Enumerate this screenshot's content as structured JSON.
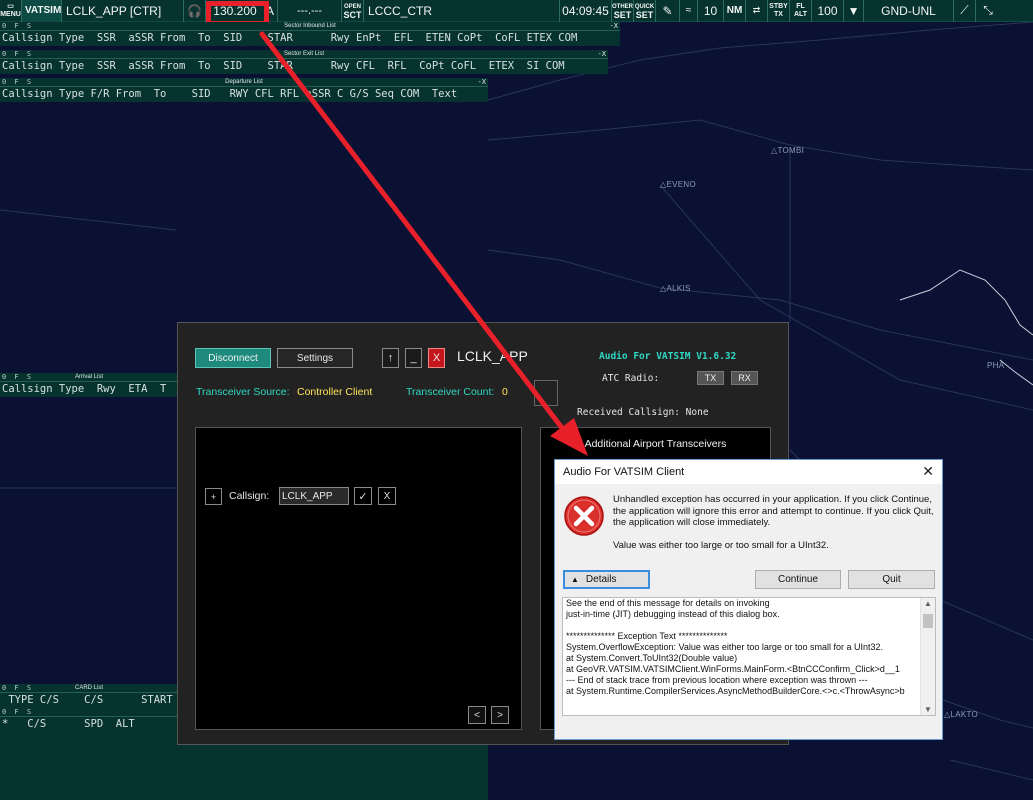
{
  "toolbar": {
    "menu": "MENU",
    "logo": "VATSIM",
    "position": "LCLK_APP [CTR]",
    "frequency": "130.200",
    "freq_suffix": "A",
    "secondary_freq": "---.---",
    "open_sct": [
      "OPEN",
      "SCT"
    ],
    "sector": "LCCC_CTR",
    "time": "04:09:45",
    "other_set": [
      "OTHER",
      "SET"
    ],
    "quick_set": [
      "QUICK",
      "SET"
    ],
    "range": "10",
    "unit": "NM",
    "stby": [
      "STBY",
      "TX"
    ],
    "fl_alt": [
      "FL",
      "ALT"
    ],
    "alt_value": "100",
    "filter": "GND-UNL"
  },
  "lists": {
    "inbound": {
      "title": "Sector Inbound List",
      "ofs": "0 F S",
      "ctl": "-X",
      "header": "Callsign Type  SSR  aSSR From  To  SID    STAR      Rwy EnPt  EFL  ETEN CoPt  CoFL ETEX COM"
    },
    "exit": {
      "title": "Sector Exit List",
      "ofs": "0 F S",
      "ctl": "-X",
      "header": "Callsign Type  SSR  aSSR From  To  SID    STAR      Rwy CFL  RFL  CoPt CoFL  ETEX  SI COM"
    },
    "departure": {
      "title": "Departure List",
      "ofs": "0 F S",
      "ctl": "-X",
      "header": "Callsign Type F/R From  To    SID   RWY CFL RFL aSSR C G/S Seq COM  Text"
    },
    "arrival": {
      "title": "Arrival List",
      "ofs": "0 F S",
      "header": "Callsign Type  Rwy  ETA  T"
    },
    "card": {
      "title": "CARD List",
      "ofs": "0 F S",
      "header": " TYPE C/S    C/S      START"
    },
    "bottom": {
      "ofs": "0 F S",
      "header": "*   C/S      SPD  ALT"
    }
  },
  "waypoints": [
    "TOMBI",
    "EVENO",
    "ALKIS",
    "PHA",
    "LAKTO"
  ],
  "afv": {
    "disconnect": "Disconnect",
    "settings": "Settings",
    "up": "↑",
    "minimize": "_",
    "close": "X",
    "title": "LCLK_APP",
    "version": "Audio For VATSIM V1.6.32",
    "atc_radio": "ATC Radio:",
    "tx": "TX",
    "rx": "RX",
    "source_label": "Transceiver Source:",
    "source_value": "Controller Client",
    "count_label": "Transceiver Count:",
    "count_value": "0",
    "received": "Received Callsign:  None",
    "plus": "+",
    "callsign_label": "Callsign:",
    "callsign_value": "LCLK_APP",
    "confirm": "✓",
    "cancel": "X",
    "prev": "<",
    "next": ">",
    "additional": "Additional Airport Transceivers"
  },
  "dialog": {
    "title": "Audio For VATSIM Client",
    "close": "✕",
    "message": "Unhandled exception has occurred in your application. If you click Continue, the application will ignore this error and attempt to continue. If you click Quit, the application will close immediately.",
    "message2": "Value was either too large or too small for a UInt32.",
    "details": "Details",
    "continue": "Continue",
    "quit": "Quit",
    "text_lines": [
      "See the end of this message for details on invoking",
      "just-in-time (JIT) debugging instead of this dialog box.",
      "",
      "************** Exception Text **************",
      "System.OverflowException: Value was either too large or too small for a UInt32.",
      "   at System.Convert.ToUInt32(Double value)",
      "   at GeoVR.VATSIM.VATSIMClient.WinForms.MainForm.<BtnCCConfirm_Click>d__1",
      "--- End of stack trace from previous location where exception was thrown ---",
      "   at System.Runtime.CompilerServices.AsyncMethodBuilderCore.<>c.<ThrowAsync>b"
    ]
  },
  "colors": {
    "toolbar_bg": "#07332f",
    "map_bg": "#0a1133",
    "accent_teal": "#2fd8c4",
    "accent_yellow": "#ffe45c",
    "highlight_red": "#e8202a"
  }
}
